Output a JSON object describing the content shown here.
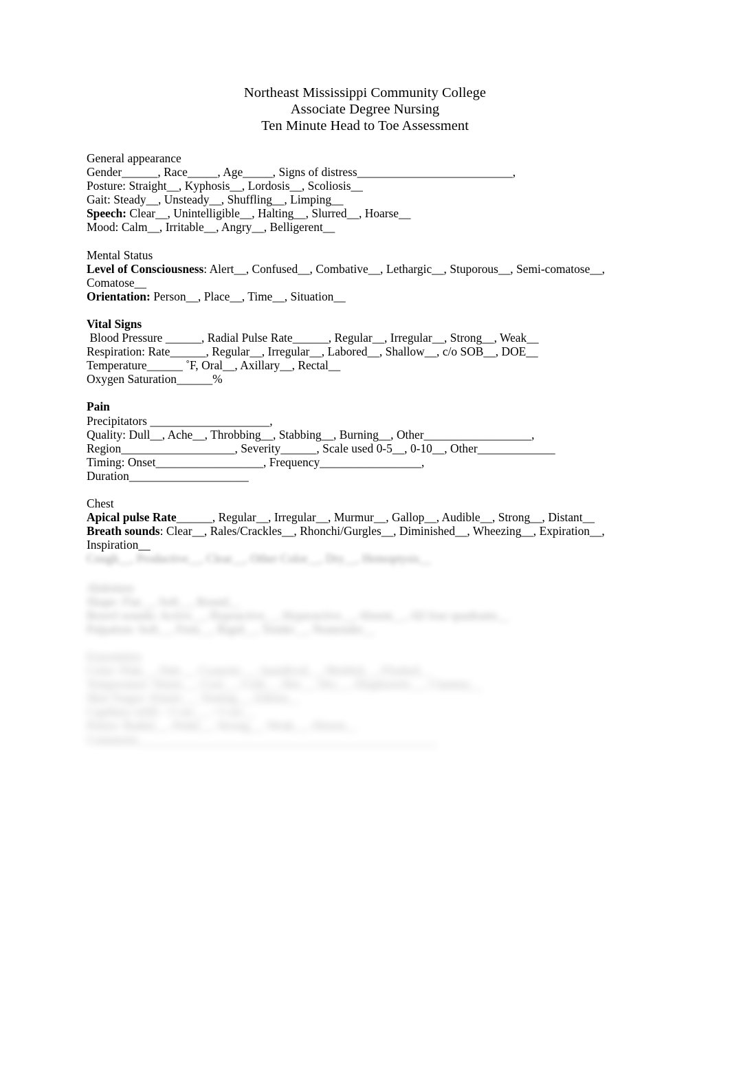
{
  "document": {
    "title_lines": [
      "Northeast Mississippi Community College",
      "Associate Degree Nursing",
      "Ten Minute Head to Toe Assessment"
    ],
    "page_background": "#ffffff",
    "text_color": "#000000"
  },
  "sections": [
    {
      "id": "general-appearance",
      "heading": "General appearance",
      "heading_bold": false,
      "lines": [
        {
          "bold_prefix": "",
          "text": "Gender______, Race_____, Age_____, Signs of distress__________________________,"
        },
        {
          "bold_prefix": "",
          "text": "Posture: Straight__, Kyphosis__, Lordosis__, Scoliosis__"
        },
        {
          "bold_prefix": "",
          "text": "Gait: Steady__, Unsteady__, Shuffling__, Limping__"
        },
        {
          "bold_prefix": "Speech:",
          "text": " Clear__, Unintelligible__, Halting__, Slurred__, Hoarse__"
        },
        {
          "bold_prefix": "",
          "text": "Mood: Calm__, Irritable__, Angry__, Belligerent__"
        }
      ]
    },
    {
      "id": "mental-status",
      "heading": "Mental Status",
      "heading_bold": false,
      "lines": [
        {
          "bold_prefix": "Level of Consciousness",
          "text": ": Alert__, Confused__, Combative__, Lethargic__, Stuporous__, Semi-comatose__, Comatose__"
        },
        {
          "bold_prefix": "Orientation:",
          "text": " Person__, Place__, Time__, Situation__"
        }
      ]
    },
    {
      "id": "vital-signs",
      "heading": "Vital Signs",
      "heading_bold": true,
      "lines": [
        {
          "bold_prefix": "",
          "text": " Blood Pressure ______, Radial Pulse Rate______, Regular__, Irregular__, Strong__, Weak__"
        },
        {
          "bold_prefix": "",
          "text": "Respiration: Rate______, Regular__, Irregular__, Labored__, Shallow__, c/o SOB__, DOE__"
        },
        {
          "bold_prefix": "",
          "text": "Temperature______ ˚F, Oral__, Axillary__, Rectal__"
        },
        {
          "bold_prefix": "",
          "text": "Oxygen Saturation______%"
        }
      ]
    },
    {
      "id": "pain",
      "heading": "Pain",
      "heading_bold": true,
      "lines": [
        {
          "bold_prefix": "",
          "text": "Precipitators ____________________,"
        },
        {
          "bold_prefix": "",
          "text": "Quality:  Dull__, Ache__, Throbbing__, Stabbing__, Burning__, Other__________________,"
        },
        {
          "bold_prefix": "",
          "text": "Region___________________, Severity______, Scale used 0-5__, 0-10__, Other_____________"
        },
        {
          "bold_prefix": "",
          "text": "Timing: Onset__________________, Frequency_________________,"
        },
        {
          "bold_prefix": "",
          "text": "Duration____________________"
        }
      ]
    },
    {
      "id": "chest",
      "heading": "Chest",
      "heading_bold": false,
      "lines": [
        {
          "bold_prefix": "Apical pulse Rate",
          "text": "______, Regular__, Irregular__, Murmur__, Gallop__, Audible__, Strong__, Distant__"
        },
        {
          "bold_prefix": "Breath sounds",
          "text": ": Clear__, Rales/Crackles__, Rhonchi/Gurgles__, Diminished__, Wheezing__, Expiration__, Inspiration__"
        }
      ]
    }
  ],
  "redacted_regions": [
    {
      "id": "redacted-block-1",
      "note": "blurred illegible line",
      "lines": [
        "Cough__, Productive__, Clear__, Other Color__, Dry__, Hemoptysis__"
      ]
    },
    {
      "id": "redacted-block-2",
      "note": "blurred illegible paragraph",
      "lines": [
        "Abdomen",
        "Shape: Flat__, Soft__, Round__",
        "Bowel sounds: Active__, Hypoactive__, Hyperactive__, Absent__, All four quadrants__",
        "Palpation: Soft__, Firm__, Rigid__, Tender__, Nontender__"
      ]
    },
    {
      "id": "redacted-block-3",
      "note": "blurred illegible paragraph",
      "lines": [
        "Extremities",
        "Color: Pink__, Pale__, Cyanotic__, Jaundiced__, Mottled__, Flushed__",
        "Temperature: Warm__, Cool__, Cold__, Hot__, Dry__, Diaphoretic__, Clammy__",
        "Skin Turgor: Elastic__, Tenting__, Edema__",
        "Capillary refill: <3 sec__, >3 sec__",
        "Pulses: Radial__, Pedal__, Strong__, Weak__, Absent__",
        "Comments__________________________________________________"
      ]
    }
  ]
}
